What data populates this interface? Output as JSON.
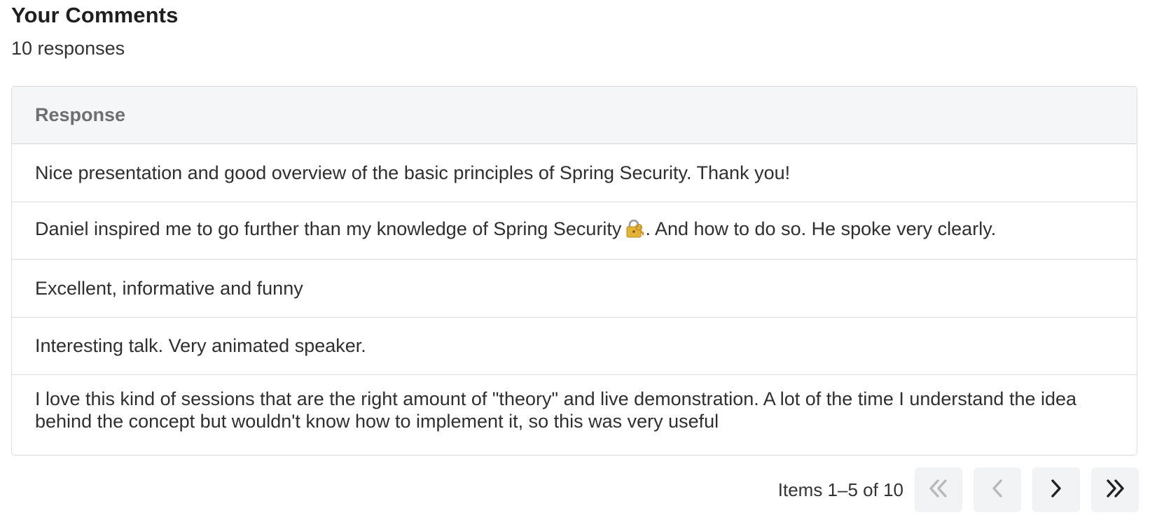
{
  "header": {
    "title": "Your Comments",
    "count_text": "10 responses"
  },
  "table": {
    "column_header": "Response",
    "rows": [
      {
        "text": "Nice presentation and good overview of the basic principles of Spring Security. Thank you!"
      },
      {
        "text_before": "Daniel inspired me to go further than my knowledge of Spring Security",
        "emoji": "closed-lock-with-key-icon",
        "text_after": ". And how to do so. He spoke very clearly."
      },
      {
        "text": "Excellent, informative and funny"
      },
      {
        "text": "Interesting talk. Very animated speaker."
      },
      {
        "text": "I love this kind of sessions that are the right amount of \"theory\" and live demonstration. A lot of the time I understand the idea behind the concept but wouldn't know how to implement it, so this was very useful"
      }
    ]
  },
  "pagination": {
    "label": "Items 1–5 of 10",
    "first_icon": "double-chevron-left-icon",
    "prev_icon": "chevron-left-icon",
    "next_icon": "chevron-right-icon",
    "last_icon": "double-chevron-right-icon",
    "first_disabled": true,
    "prev_disabled": true,
    "next_disabled": false,
    "last_disabled": false
  }
}
